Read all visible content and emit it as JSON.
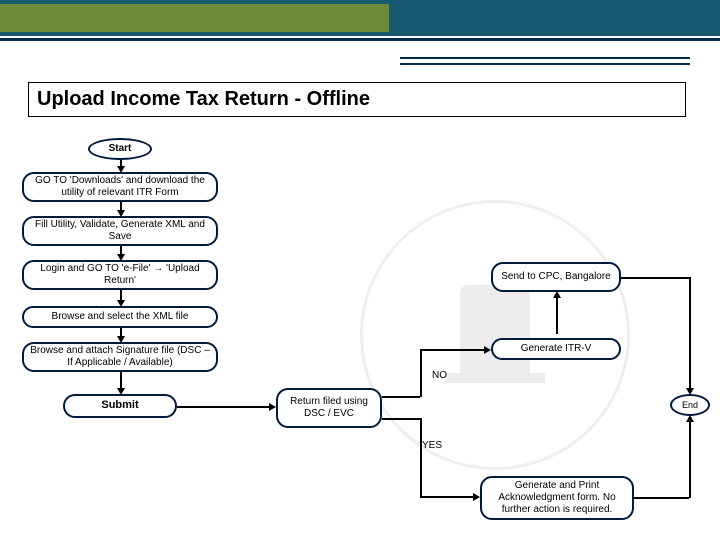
{
  "header": {
    "title": "Upload Income Tax Return - Offline"
  },
  "flow": {
    "start": "Start",
    "step1": "GO TO 'Downloads' and download the utility of relevant ITR Form",
    "step2": "Fill Utility, Validate, Generate XML and Save",
    "step3": "Login and GO TO 'e-File' → 'Upload Return'",
    "step4": "Browse and select the XML file",
    "step5": "Browse and attach Signature file (DSC – If Applicable / Available)",
    "submit": "Submit",
    "decision": "Return filed using DSC / EVC",
    "yes": "YES",
    "no": "NO",
    "generate_itrv": "Generate ITR-V",
    "send_cpc": "Send to CPC, Bangalore",
    "ack": "Generate and Print Acknowledgment form. No further action is required.",
    "end": "End"
  },
  "chart_data": {
    "type": "flowchart",
    "title": "Upload Income Tax Return - Offline",
    "nodes": [
      {
        "id": "start",
        "shape": "terminator",
        "text": "Start"
      },
      {
        "id": "s1",
        "shape": "process",
        "text": "GO TO 'Downloads' and download the utility of relevant ITR Form"
      },
      {
        "id": "s2",
        "shape": "process",
        "text": "Fill Utility, Validate, Generate XML and Save"
      },
      {
        "id": "s3",
        "shape": "process",
        "text": "Login and GO TO 'e-File' → 'Upload Return'"
      },
      {
        "id": "s4",
        "shape": "process",
        "text": "Browse and select the XML file"
      },
      {
        "id": "s5",
        "shape": "process",
        "text": "Browse and attach Signature file (DSC – If Applicable / Available)"
      },
      {
        "id": "submit",
        "shape": "process",
        "text": "Submit"
      },
      {
        "id": "dec",
        "shape": "decision",
        "text": "Return filed using DSC / EVC"
      },
      {
        "id": "itrv",
        "shape": "process",
        "text": "Generate ITR-V"
      },
      {
        "id": "cpc",
        "shape": "process",
        "text": "Send to CPC, Bangalore"
      },
      {
        "id": "ack",
        "shape": "process",
        "text": "Generate and Print Acknowledgment form. No further action is required."
      },
      {
        "id": "end",
        "shape": "terminator",
        "text": "End"
      }
    ],
    "edges": [
      {
        "from": "start",
        "to": "s1"
      },
      {
        "from": "s1",
        "to": "s2"
      },
      {
        "from": "s2",
        "to": "s3"
      },
      {
        "from": "s3",
        "to": "s4"
      },
      {
        "from": "s4",
        "to": "s5"
      },
      {
        "from": "s5",
        "to": "submit"
      },
      {
        "from": "submit",
        "to": "dec"
      },
      {
        "from": "dec",
        "to": "itrv",
        "label": "NO"
      },
      {
        "from": "dec",
        "to": "ack",
        "label": "YES"
      },
      {
        "from": "itrv",
        "to": "cpc"
      },
      {
        "from": "cpc",
        "to": "end"
      },
      {
        "from": "ack",
        "to": "end"
      }
    ]
  }
}
